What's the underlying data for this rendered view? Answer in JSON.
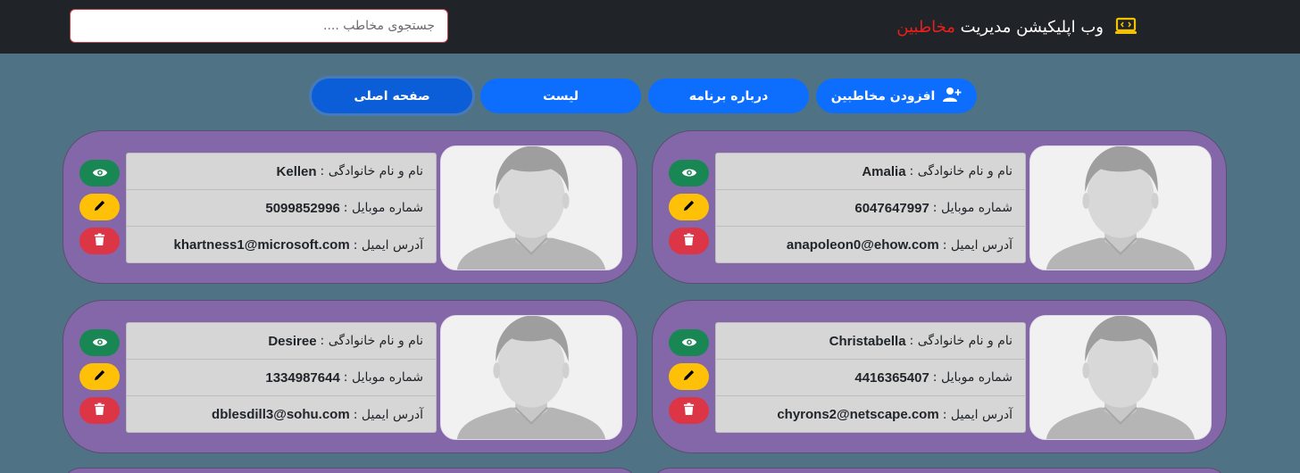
{
  "navbar": {
    "brand_prefix": "وب اپلیکیشن مدیریت",
    "brand_accent": "مخاطبین",
    "brand_accent_color": "#e8201c",
    "brand_icon": "laptop-code-icon",
    "search_placeholder": "جستجوی مخاطب ...."
  },
  "menu": {
    "home": "صفحه اصلی",
    "list": "لیست",
    "about": "درباره برنامه",
    "add": "افزودن مخاطبین"
  },
  "labels": {
    "name": "نام و نام خانوادگی :",
    "phone": "شماره موبایل :",
    "email": "آدرس ایمیل :"
  },
  "contacts": [
    {
      "name": "Amalia",
      "phone": "6047647997",
      "email": "anapoleon0@ehow.com"
    },
    {
      "name": "Kellen",
      "phone": "5099852996",
      "email": "khartness1@microsoft.com"
    },
    {
      "name": "Christabella",
      "phone": "4416365407",
      "email": "chyrons2@netscape.com"
    },
    {
      "name": "Desiree",
      "phone": "1334987644",
      "email": "dblesdill3@sohu.com"
    }
  ],
  "colors": {
    "background": "#4f7384",
    "card": "#8467a8",
    "primary": "#0d6efd",
    "view": "#198754",
    "edit": "#ffc107",
    "delete": "#dc3545"
  }
}
